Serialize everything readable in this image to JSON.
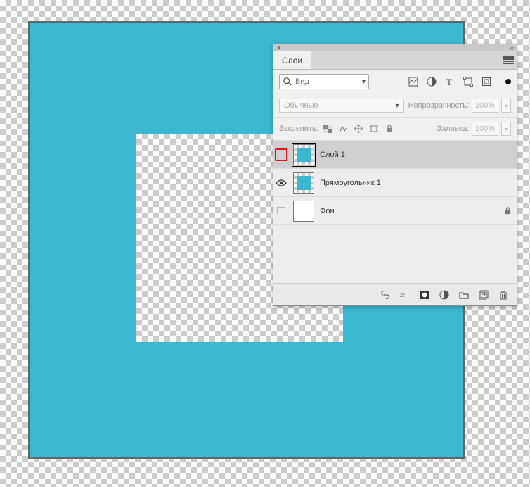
{
  "panel": {
    "title": "Слои",
    "search_placeholder": "Вид",
    "blend_mode": "Обычные",
    "opacity_label": "Непрозрачность:",
    "opacity_value": "100%",
    "lock_label": "Закрепить:",
    "fill_label": "Заливка:",
    "fill_value": "100%"
  },
  "layers": [
    {
      "name": "Слой 1"
    },
    {
      "name": "Прямоугольник 1"
    },
    {
      "name": "Фон"
    }
  ],
  "colors": {
    "shape": "#3bb8cf"
  }
}
